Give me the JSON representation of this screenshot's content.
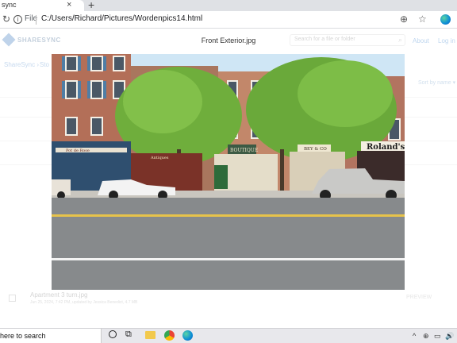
{
  "browser": {
    "tab_title": "sync",
    "url_scheme_label": "File",
    "url": "C:/Users/Richard/Pictures/Wordenpics14.html",
    "new_tab_glyph": "+",
    "close_glyph": "×"
  },
  "page": {
    "brand": "SHARESYNC",
    "viewer_title": "Front Exterior.jpg",
    "search_placeholder": "Search for a file or folder",
    "nav_about": "About",
    "nav_login": "Log in",
    "breadcrumb_root": "ShareSync",
    "breadcrumb_sep": "›",
    "breadcrumb_next": "Sto",
    "sort_label": "Sort by name ▾",
    "file_row": {
      "name": "Apartment 3 turn.jpg",
      "meta": "Jun 25, 2024, 7:42 PM, updated by Jessica Benedict, 4.7 MB",
      "preview": "PREVIEW"
    }
  },
  "photo": {
    "signs": [
      "Pot de Rose",
      "Antiques",
      "BOUTIQUE",
      "BEY & CO",
      "Roland's"
    ]
  },
  "taskbar": {
    "search_text": "here to search",
    "tray_glyphs": [
      "^",
      "⊕",
      "▭",
      "🔊"
    ]
  },
  "colors": {
    "accent": "#2b78c5",
    "brick": "#b3705a",
    "foliage": "#6fae3c",
    "road": "#878a8c"
  }
}
